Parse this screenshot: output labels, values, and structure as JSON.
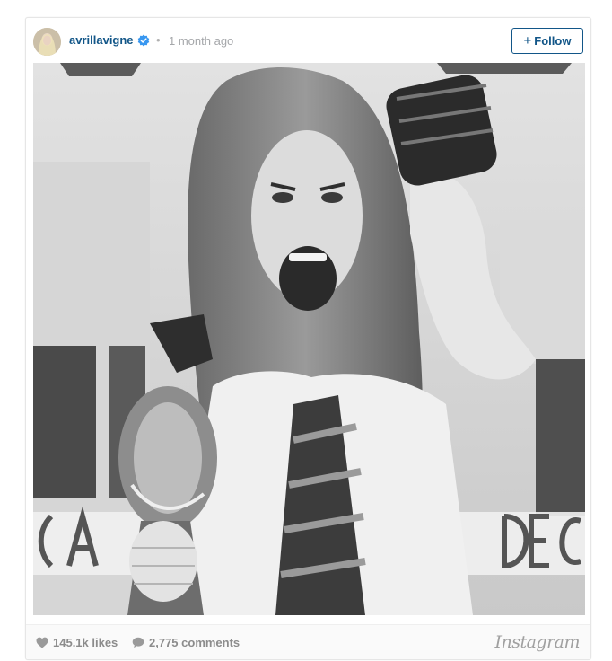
{
  "post": {
    "username": "avrillavigne",
    "separator": "•",
    "time_ago": "1 month ago",
    "follow_label": "Follow",
    "follow_prefix": "+",
    "likes": "145.1k likes",
    "comments": "2,775 comments",
    "brand": "Instagram"
  },
  "colors": {
    "username": "#125688",
    "verified": "#3897f0",
    "muted": "#8c8c8c"
  },
  "icons": {
    "verified": "verified-badge-icon",
    "like": "heart-icon",
    "comment": "speech-bubble-icon"
  }
}
